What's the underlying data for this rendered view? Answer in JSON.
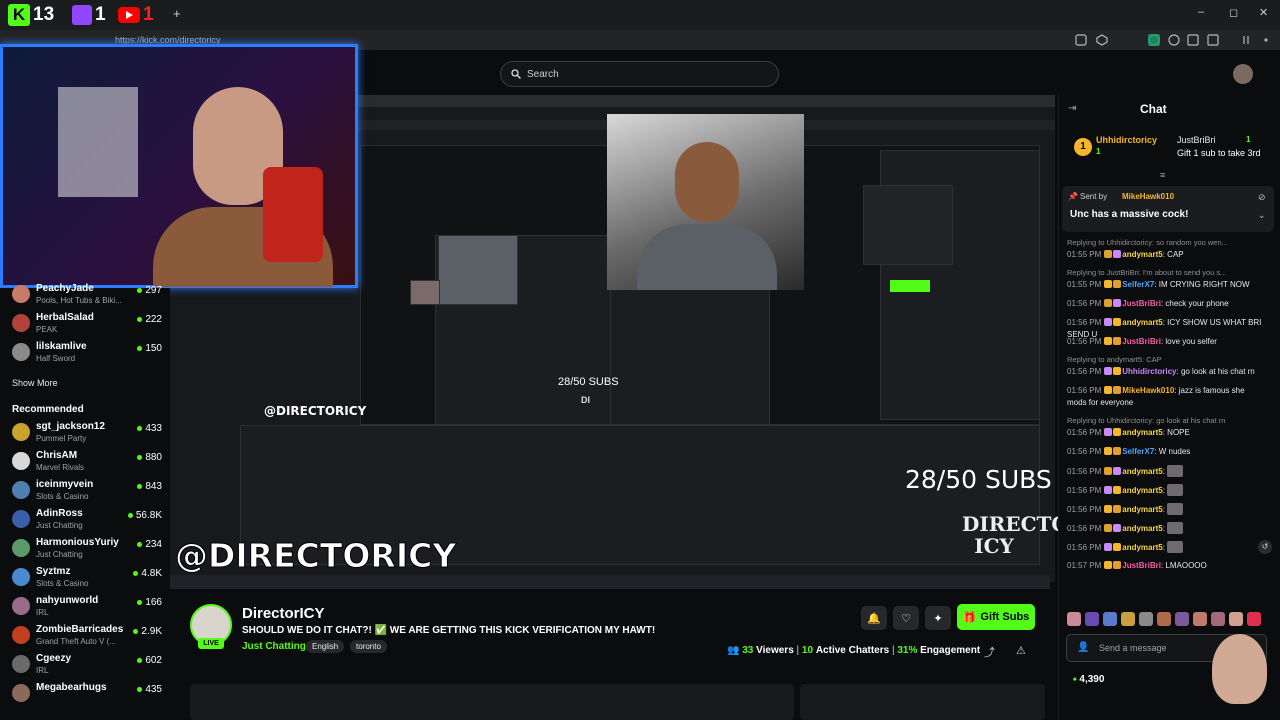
{
  "browser": {
    "badges": [
      {
        "label": "13",
        "icon": "kick-icon"
      },
      {
        "label": "1",
        "icon": "twitch-icon"
      },
      {
        "label": "1",
        "icon": "youtube-icon"
      }
    ],
    "new_tab": "+",
    "url": "https://kick.com/directoricy",
    "window_controls": [
      "–",
      "◻",
      "✕"
    ]
  },
  "header": {
    "search_placeholder": "Search"
  },
  "sidebar": {
    "following": [
      {
        "name": "PeachyJade",
        "game": "Pools, Hot Tubs & Biki...",
        "viewers": "297",
        "color": "#c97a6a"
      },
      {
        "name": "HerbalSalad",
        "game": "PEAK",
        "viewers": "222",
        "color": "#b0433a"
      },
      {
        "name": "lilskamlive",
        "game": "Half Sword",
        "viewers": "150",
        "color": "#8a8a8a"
      }
    ],
    "show_more": "Show More",
    "recommended_title": "Recommended",
    "recommended": [
      {
        "name": "sgt_jackson12",
        "game": "Pummel Party",
        "viewers": "433",
        "color": "#c9a230"
      },
      {
        "name": "ChrisAM",
        "game": "Marvel Rivals",
        "viewers": "880",
        "color": "#d8d8d8"
      },
      {
        "name": "iceinmyvein",
        "game": "Slots & Casino",
        "viewers": "843",
        "color": "#4f7fb0"
      },
      {
        "name": "AdinRoss",
        "game": "Just Chatting",
        "viewers": "56.8K",
        "color": "#3a5fa8"
      },
      {
        "name": "HarmoniousYuriy",
        "game": "Just Chatting",
        "viewers": "234",
        "color": "#5a9a6a"
      },
      {
        "name": "Syztmz",
        "game": "Slots & Casino",
        "viewers": "4.8K",
        "color": "#4a8ad0"
      },
      {
        "name": "nahyunworld",
        "game": "IRL",
        "viewers": "166",
        "color": "#9a6a8a"
      },
      {
        "name": "ZombieBarricades",
        "game": "Grand Theft Auto V (...",
        "viewers": "2.9K",
        "color": "#c04020"
      },
      {
        "name": "Cgeezy",
        "game": "IRL",
        "viewers": "602",
        "color": "#6a6a6a"
      },
      {
        "name": "Megabearhugs",
        "game": "",
        "viewers": "435",
        "color": "#8a6a5a"
      }
    ]
  },
  "stream": {
    "overlay_handle": "@DIRECTORICY",
    "overlay_subs": "28/50 SUBS",
    "overlay_logo": "DIRECTOR ICY"
  },
  "info": {
    "streamer": "DirectorICY",
    "live": "LIVE",
    "title": "SHOULD WE DO IT CHAT?! ✅ WE ARE GETTING THIS KICK VERIFICATION MY HAWT!",
    "category": "Just Chatting",
    "tags": [
      "English",
      "toronto"
    ],
    "gift_label": "Gift Subs",
    "viewers": "33",
    "viewers_label": "Viewers",
    "chatters": "10",
    "chatters_label": "Active Chatters",
    "engagement": "31%",
    "engagement_label": "Engagement"
  },
  "chat": {
    "title": "Chat",
    "sub_gifter": "Uhhidirctoricy",
    "sub_gifter_count": "1",
    "sub_target": "JustBriBri",
    "sub_target_count": "1",
    "sub_text": "Gift 1 sub to take 3rd",
    "pinned_sender_label": "Sent by",
    "pinned_sender": "MikeHawk010",
    "pinned_text": "Unc has a massive cock!",
    "messages": [
      {
        "reply": "Replying to Uhhidirctoricy: so random you wen..."
      },
      {
        "time": "01:55 PM",
        "user": "andymart5",
        "cls": "u-yellow",
        "text": "CAP"
      },
      {
        "reply": "Replying to JustBriBri: I'm about to send you s..."
      },
      {
        "time": "01:55 PM",
        "user": "SelferX7",
        "cls": "u-blue",
        "text": "IM CRYING RIGHT NOW"
      },
      {
        "time": "01:56 PM",
        "user": "JustBriBri",
        "cls": "u-pink",
        "text": "check your phone"
      },
      {
        "time": "01:56 PM",
        "user": "andymart5",
        "cls": "u-yellow",
        "text": "ICY SHOW US WHAT BRI SEND U"
      },
      {
        "time": "01:56 PM",
        "user": "JustBriBri",
        "cls": "u-pink",
        "text": "love you selfer"
      },
      {
        "reply": "Replying to andymart5: CAP"
      },
      {
        "time": "01:56 PM",
        "user": "Uhhidirctoricy",
        "cls": "u-lav",
        "text": "go look at his chat rn"
      },
      {
        "time": "01:56 PM",
        "user": "MikeHawk010",
        "cls": "u-gold",
        "text": "jazz is famous she mods for everyone"
      },
      {
        "reply": "Replying to Uhhidirctoricy: go look at his chat rn"
      },
      {
        "time": "01:56 PM",
        "user": "andymart5",
        "cls": "u-yellow",
        "text": "NOPE"
      },
      {
        "time": "01:56 PM",
        "user": "SelferX7",
        "cls": "u-blue",
        "text": "W nudes"
      },
      {
        "time": "01:56 PM",
        "user": "andymart5",
        "cls": "u-yellow",
        "text": ""
      },
      {
        "time": "01:56 PM",
        "user": "andymart5",
        "cls": "u-yellow",
        "text": ""
      },
      {
        "time": "01:56 PM",
        "user": "andymart5",
        "cls": "u-yellow",
        "text": ""
      },
      {
        "time": "01:56 PM",
        "user": "andymart5",
        "cls": "u-yellow",
        "text": ""
      },
      {
        "time": "01:56 PM",
        "user": "andymart5",
        "cls": "u-yellow",
        "text": ""
      },
      {
        "time": "01:57 PM",
        "user": "JustBriBri",
        "cls": "u-pink",
        "text": "LMAOOOO"
      }
    ],
    "input_placeholder": "Send a message",
    "points": "4,390"
  },
  "colors": {
    "accent": "#53fc18",
    "background": "#0b0c0e",
    "webcam_border": "#2b7cff"
  }
}
